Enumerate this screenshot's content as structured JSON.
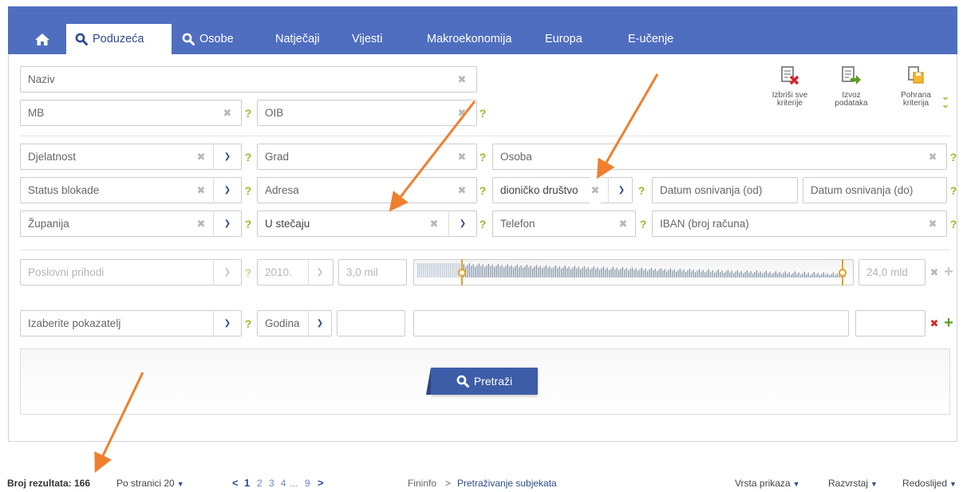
{
  "nav": {
    "tabs": [
      {
        "label": "Poduzeća"
      },
      {
        "label": "Osobe"
      },
      {
        "label": "Natječaji"
      },
      {
        "label": "Vijesti"
      },
      {
        "label": "Makroekonomija"
      },
      {
        "label": "Europa"
      },
      {
        "label": "E-učenje"
      }
    ]
  },
  "tools": {
    "clear_all": "Izbriši sve kriterije",
    "export": "Izvoz podataka",
    "save": "Pohrana kriterija"
  },
  "fields": {
    "naziv": "Naziv",
    "mb": "MB",
    "oib": "OIB",
    "djelatnost": "Djelatnost",
    "grad": "Grad",
    "osoba": "Osoba",
    "status_blokade": "Status blokade",
    "adresa": "Adresa",
    "pravni_oblik": "dioničko društvo",
    "datum_od": "Datum osnivanja (od)",
    "datum_do": "Datum osnivanja (do)",
    "zupanija": "Županija",
    "u_stecaju": "U stečaju",
    "telefon": "Telefon",
    "iban": "IBAN (broj računa)"
  },
  "range": {
    "indicator": "Poslovni prihodi",
    "year": "2010.",
    "min": "3,0 mil",
    "max": "24,0 mld"
  },
  "indicator_row": {
    "indicator": "Izaberite pokazatelj",
    "year": "Godina"
  },
  "search": {
    "label": "Pretraži"
  },
  "footer": {
    "result_count": "Broj rezultata: 166",
    "per_page": "Po stranici 20",
    "pages": {
      "prev": "<",
      "current": "1",
      "p2": "2",
      "p3": "3",
      "p4": "4",
      "ellipsis": "...",
      "last": "9",
      "next": ">"
    },
    "breadcrumb_root": "Fininfo",
    "breadcrumb_sep": ">",
    "breadcrumb_page": "Pretraživanje subjekata",
    "view": "Vrsta prikaza",
    "sort": "Razvrstaj",
    "order": "Redoslijed"
  },
  "colors": {
    "nav_bg": "#4f6ebf",
    "accent": "#2e4a8f",
    "help": "#9aba25",
    "annotation_arrow": "#f07f2d"
  }
}
